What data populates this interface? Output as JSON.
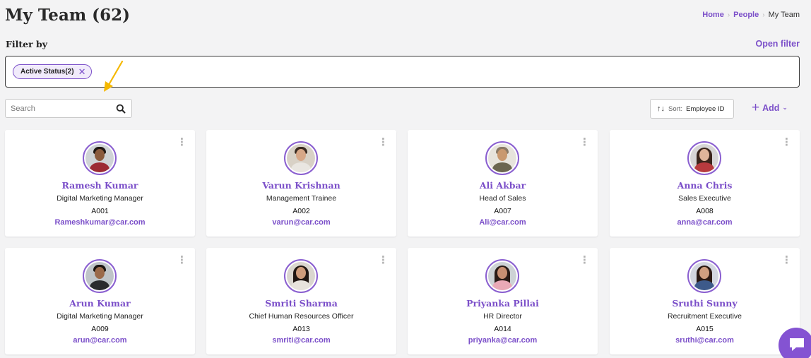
{
  "header": {
    "title": "My Team (62)",
    "breadcrumb": [
      {
        "label": "Home"
      },
      {
        "label": "People"
      },
      {
        "label": "My Team"
      }
    ]
  },
  "filter": {
    "label": "Filter by",
    "open_filter": "Open filter",
    "chips": [
      {
        "label": "Active Status(2)",
        "remove": "✕"
      }
    ]
  },
  "toolbar": {
    "search_placeholder": "Search",
    "sort_prefix": "Sort:",
    "sort_value": "Employee ID",
    "sort_icon": "↑↓",
    "add_label": "Add"
  },
  "colors": {
    "accent": "#7b4fc9",
    "arrow": "#f5b800"
  },
  "employees": [
    {
      "name": "Ramesh Kumar",
      "role": "Digital Marketing Manager",
      "id": "A001",
      "email": "Rameshkumar@car.com",
      "avatar": {
        "bg": "#cfd3d6",
        "skin": "#8a5a3c",
        "hair": "#1e1713",
        "shirt": "#9c2a33",
        "long_hair": false
      }
    },
    {
      "name": "Varun Krishnan",
      "role": "Management Trainee",
      "id": "A002",
      "email": "varun@car.com",
      "avatar": {
        "bg": "#d8d1c6",
        "skin": "#d7a787",
        "hair": "#3a2a20",
        "shirt": "#e9e6e1",
        "long_hair": false
      }
    },
    {
      "name": "Ali Akbar",
      "role": "Head of Sales",
      "id": "A007",
      "email": "Ali@car.com",
      "avatar": {
        "bg": "#e7e4dc",
        "skin": "#c9996f",
        "hair": "#8a7a66",
        "shirt": "#6b6650",
        "long_hair": false
      }
    },
    {
      "name": "Anna Chris",
      "role": "Sales Executive",
      "id": "A008",
      "email": "anna@car.com",
      "avatar": {
        "bg": "#d7d5d6",
        "skin": "#e0b49a",
        "hair": "#3a241b",
        "shirt": "#b73a3e",
        "long_hair": true
      }
    },
    {
      "name": "Arun Kumar",
      "role": "Digital Marketing Manager",
      "id": "A009",
      "email": "arun@car.com",
      "avatar": {
        "bg": "#bfc4c8",
        "skin": "#9b6a4a",
        "hair": "#1a1410",
        "shirt": "#2b2b2e",
        "long_hair": false
      }
    },
    {
      "name": "Smriti Sharma",
      "role": "Chief Human Resources Officer",
      "id": "A013",
      "email": "smriti@car.com",
      "avatar": {
        "bg": "#dad6cf",
        "skin": "#cf9c7b",
        "hair": "#201612",
        "shirt": "#e8e3dc",
        "long_hair": true
      }
    },
    {
      "name": "Priyanka Pillai",
      "role": "HR Director",
      "id": "A014",
      "email": "priyanka@car.com",
      "avatar": {
        "bg": "#cdd2d5",
        "skin": "#c98f72",
        "hair": "#2a1b16",
        "shirt": "#e9a9b6",
        "long_hair": true
      }
    },
    {
      "name": "Sruthi Sunny",
      "role": "Recruitment Executive",
      "id": "A015",
      "email": "sruthi@car.com",
      "avatar": {
        "bg": "#d3d7e0",
        "skin": "#d09f80",
        "hair": "#2b1a13",
        "shirt": "#3d5a8a",
        "long_hair": true
      }
    }
  ]
}
